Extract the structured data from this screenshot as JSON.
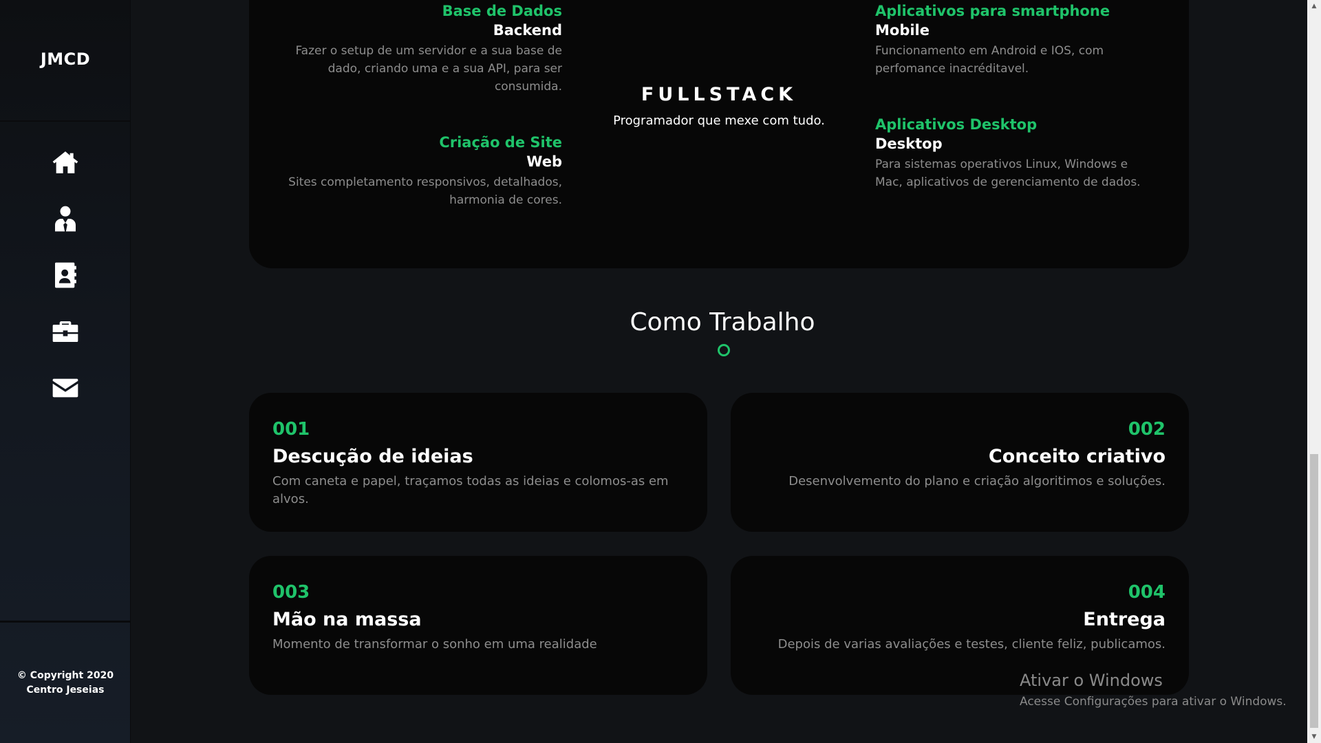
{
  "sidebar": {
    "logo": "JMCD",
    "nav": [
      {
        "icon": "home-icon"
      },
      {
        "icon": "user-icon"
      },
      {
        "icon": "contact-card-icon"
      },
      {
        "icon": "briefcase-icon"
      },
      {
        "icon": "mail-icon"
      }
    ],
    "copyright_line1": "© Copyright 2020",
    "copyright_line2": "Centro Jeseias"
  },
  "services": {
    "center": {
      "heading": "FULLSTACK",
      "subtitle": "Programador que mexe com tudo."
    },
    "left": [
      {
        "title": "Base de Dados",
        "subtitle": "Backend",
        "desc_lines": [
          "Fazer o setup de um servidor e a sua base de",
          "dado, criando uma e a sua API, para ser",
          "consumida."
        ]
      },
      {
        "title": "Criação de Site",
        "subtitle": "Web",
        "desc_lines": [
          "Sites completamento responsivos, detalhados,",
          "harmonia de cores."
        ]
      }
    ],
    "right": [
      {
        "title": "Aplicativos para smartphone",
        "subtitle": "Mobile",
        "desc_lines": [
          "Funcionamento em Android e IOS, com",
          "perfomance inacréditavel."
        ]
      },
      {
        "title": "Aplicativos Desktop",
        "subtitle": "Desktop",
        "desc_lines": [
          "Para sistemas operativos Linux, Windows e",
          "Mac, aplicativos de gerenciamento de dados."
        ]
      }
    ]
  },
  "how_i_work": {
    "title": "Como Trabalho",
    "steps": [
      {
        "number": "001",
        "title": "Descução de ideias",
        "desc_lines": [
          "Com caneta e papel, traçamos todas as ideias e colomos-as em",
          "alvos."
        ]
      },
      {
        "number": "002",
        "title": "Conceito criativo",
        "desc_lines": [
          "Desenvolvemento do plano e criação algoritimos e soluções."
        ]
      },
      {
        "number": "003",
        "title": "Mão na massa",
        "desc_lines": [
          "Momento de transformar o sonho em uma realidade"
        ]
      },
      {
        "number": "004",
        "title": "Entrega",
        "desc_lines": [
          "Depois de varias avaliações e testes, cliente feliz, publicamos."
        ]
      }
    ]
  },
  "watermark": {
    "title": "Ativar o Windows",
    "subtitle": "Acesse Configurações para ativar o Windows."
  },
  "colors": {
    "accent": "#1fc36a",
    "background": "#111316",
    "card": "#070707",
    "muted_text": "#8d8d8d"
  }
}
